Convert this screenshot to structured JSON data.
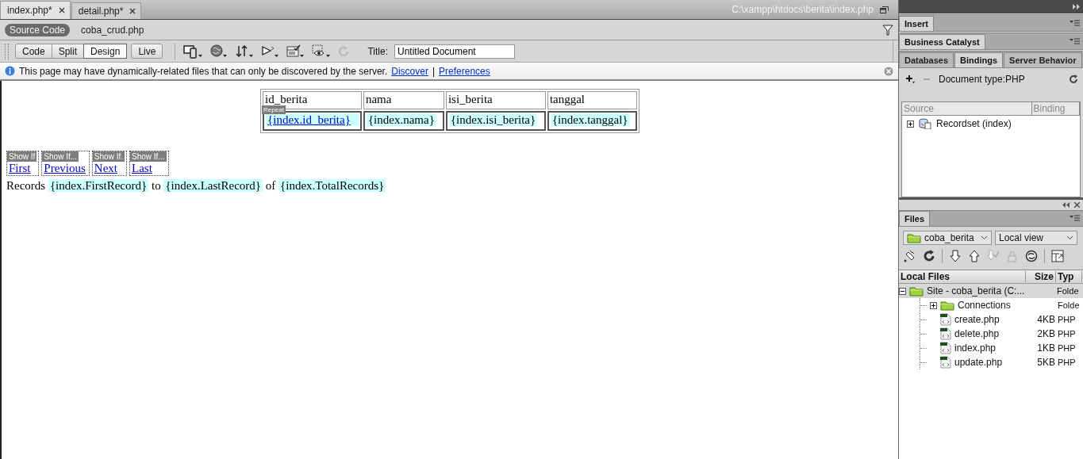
{
  "document_tabs": [
    {
      "label": "index.php*",
      "selected": true
    },
    {
      "label": "detail.php*",
      "selected": false
    }
  ],
  "file_path": "C:\\xampp\\htdocs\\berita\\index.php",
  "related_files": [
    {
      "label": "Source Code",
      "selected": true
    },
    {
      "label": "coba_crud.php",
      "selected": false
    }
  ],
  "view_buttons": [
    {
      "label": "Code",
      "selected": false
    },
    {
      "label": "Split",
      "selected": false
    },
    {
      "label": "Design",
      "selected": true
    },
    {
      "label": "Live",
      "selected": false
    }
  ],
  "title_field": {
    "label": "Title:",
    "value": "Untitled Document"
  },
  "info_bar": {
    "message": "This page may have dynamically-related files that can only be discovered by the server.",
    "links": [
      "Discover",
      "Preferences"
    ],
    "separator": "|"
  },
  "design": {
    "table": {
      "columns": [
        "id_berita",
        "nama",
        "isi_berita",
        "tanggal"
      ],
      "cells": [
        {
          "text": "{index.id_berita}",
          "kind": "link"
        },
        {
          "text": "{index.nama}",
          "kind": "binding"
        },
        {
          "text": "{index.isi_berita}",
          "kind": "binding"
        },
        {
          "text": "{index.tanggal}",
          "kind": "binding"
        }
      ],
      "repeat_tag": "Repeat"
    },
    "nav_links": [
      {
        "tag": "Show If",
        "label": "First"
      },
      {
        "tag": "Show If...",
        "label": "Previous"
      },
      {
        "tag": "Show If.",
        "label": "Next"
      },
      {
        "tag": "Show If...",
        "label": "Last"
      }
    ],
    "records_line": [
      {
        "text": "Records ",
        "kind": "plain"
      },
      {
        "text": "{index.FirstRecord}",
        "kind": "binding"
      },
      {
        "text": " to ",
        "kind": "plain"
      },
      {
        "text": "{index.LastRecord}",
        "kind": "binding"
      },
      {
        "text": " of ",
        "kind": "plain"
      },
      {
        "text": "{index.TotalRecords}",
        "kind": "binding"
      }
    ]
  },
  "panels": {
    "insert_tab": "Insert",
    "business_catalyst_tab": "Business Catalyst",
    "binding_tabs": [
      {
        "label": "Databases",
        "selected": false
      },
      {
        "label": "Bindings",
        "selected": true
      },
      {
        "label": "Server Behavior",
        "selected": false
      }
    ],
    "document_type": "Document type:PHP",
    "binding_columns": [
      "Source",
      "Binding"
    ],
    "bindings": [
      {
        "label": "Recordset (index)",
        "expanded": false
      }
    ]
  },
  "files": {
    "tab": "Files",
    "site": "coba_berita",
    "view": "Local view",
    "columns": [
      "Local Files",
      "Size",
      "Typ"
    ],
    "tree": [
      {
        "name": "Site - coba_berita (C:...",
        "type": "Folde",
        "kind": "site",
        "expanded": true,
        "selected": true,
        "children": [
          {
            "name": "Connections",
            "type": "Folde",
            "kind": "folder",
            "expanded": false,
            "selected": false
          },
          {
            "name": "create.php",
            "size": "4KB",
            "type": "PHP",
            "kind": "file",
            "selected": false
          },
          {
            "name": "delete.php",
            "size": "2KB",
            "type": "PHP",
            "kind": "file",
            "selected": false
          },
          {
            "name": "index.php",
            "size": "1KB",
            "type": "PHP",
            "kind": "file",
            "selected": false
          },
          {
            "name": "update.php",
            "size": "5KB",
            "type": "PHP",
            "kind": "file",
            "selected": false
          }
        ]
      }
    ]
  }
}
